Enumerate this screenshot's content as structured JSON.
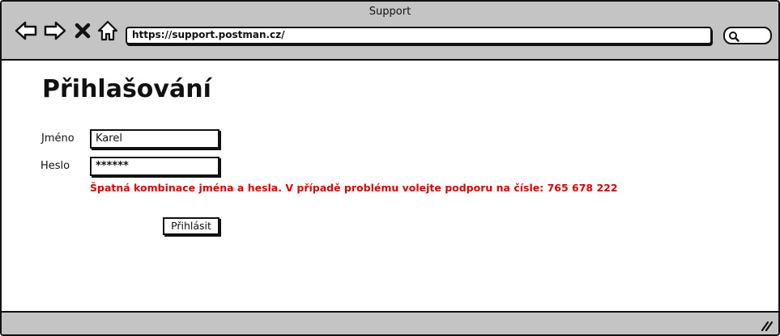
{
  "window": {
    "title": "Support"
  },
  "toolbar": {
    "url": "https://support.postman.cz/"
  },
  "icons": {
    "back": "back-arrow-icon",
    "forward": "forward-arrow-icon",
    "stop": "close-icon",
    "home": "home-icon",
    "search": "search-icon",
    "resize": "resize-grip-icon"
  },
  "login": {
    "title": "Přihlašování",
    "name_label": "Jméno",
    "name_value": "Karel",
    "password_label": "Heslo",
    "password_value": "******",
    "error_message": "Špatná kombinace jména a hesla. V případě problému volejte podporu na čísle: 765 678 222",
    "submit_label": "Přihlásit"
  },
  "colors": {
    "chrome": "#c4c4c4",
    "error": "#e00000",
    "ink": "#111111"
  }
}
